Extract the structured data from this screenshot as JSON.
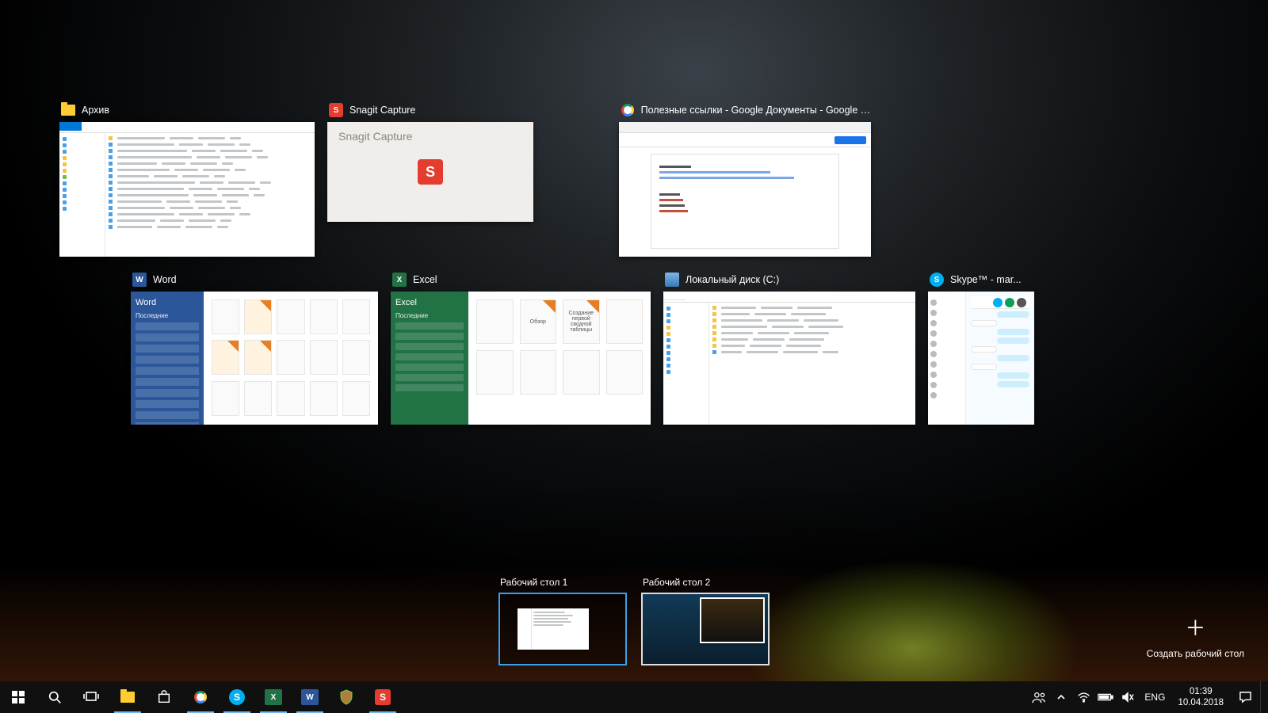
{
  "windows": {
    "archive": {
      "title": "Архив"
    },
    "snagit": {
      "title": "Snagit Capture",
      "inner_label": "Snagit Capture"
    },
    "chrome": {
      "title": "Полезные ссылки - Google Документы - Google C..."
    },
    "word": {
      "title": "Word",
      "side_title": "Word",
      "side_sub": "Последние"
    },
    "excel": {
      "title": "Excel",
      "side_title": "Excel",
      "side_sub": "Последние",
      "tiles": [
        "",
        "Обзор",
        "Создание первой сводной таблицы",
        ""
      ]
    },
    "localdisk": {
      "title": "Локальный диск (C:)"
    },
    "skype": {
      "title": "Skype™ - mar..."
    }
  },
  "desktops": {
    "d1": "Рабочий стол 1",
    "d2": "Рабочий стол 2",
    "new": "Создать рабочий стол"
  },
  "taskbar": {
    "lang": "ENG",
    "time": "01:39",
    "date": "10.04.2018"
  }
}
